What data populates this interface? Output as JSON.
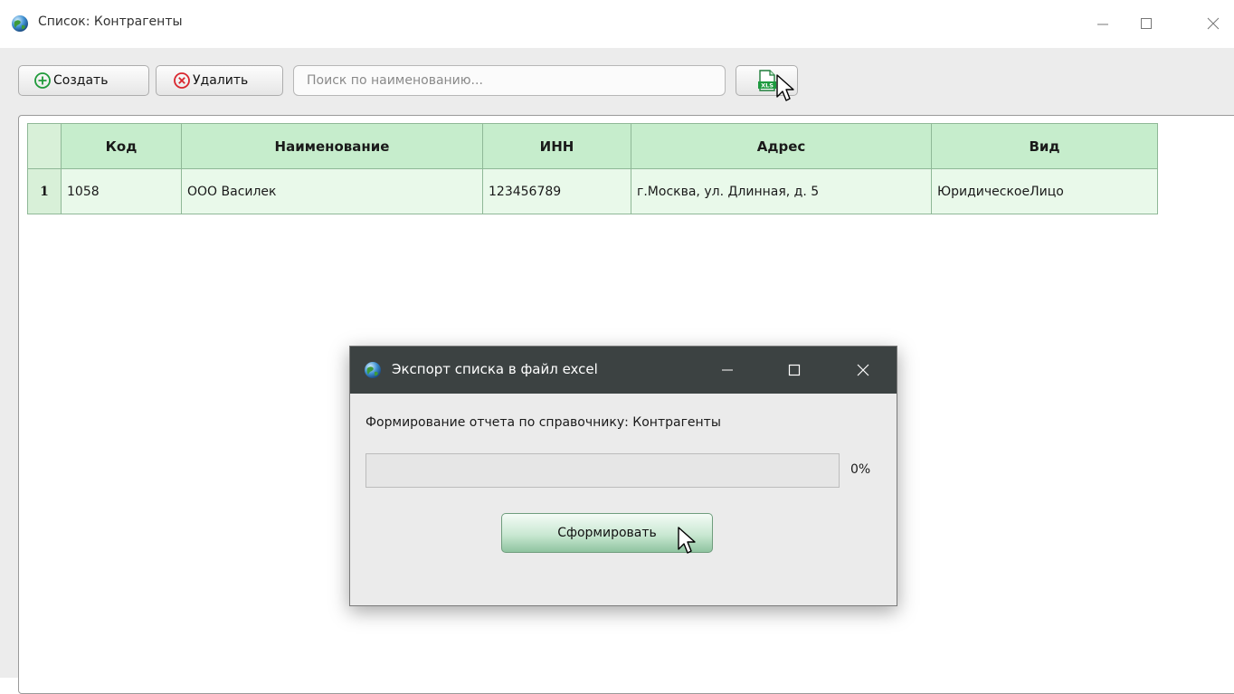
{
  "window": {
    "title": "Список: Контрагенты",
    "controls": {
      "minimize": "—",
      "maximize": "☐",
      "close": "✕"
    }
  },
  "toolbar": {
    "create_label": "Создать",
    "delete_label": "Удалить",
    "search_placeholder": "Поиск по наименованию...",
    "search_value": "",
    "export_icon": "xls-file-icon"
  },
  "table": {
    "columns": [
      "Код",
      "Наименование",
      "ИНН",
      "Адрес",
      "Вид"
    ],
    "rows": [
      {
        "num": "1",
        "cells": [
          "1058",
          "ООО Василек",
          "123456789",
          "г.Москва, ул. Длинная, д. 5",
          "ЮридическоеЛицо"
        ]
      }
    ]
  },
  "dialog": {
    "title": "Экспорт списка в файл excel",
    "message": "Формирование отчета по справочнику: Контрагенты",
    "progress_percent": 0,
    "progress_text": "0%",
    "button_label": "Сформировать"
  },
  "colors": {
    "header_bg": "#c6edcc",
    "row_bg": "#e9f9ea",
    "dialog_title_bg": "#3c4242",
    "progress_fill": "#06b025"
  }
}
